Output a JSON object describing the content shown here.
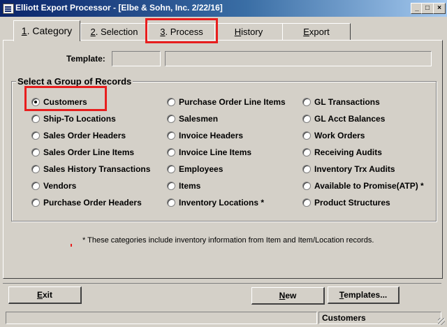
{
  "window": {
    "title": "Elliott Export Processor - [Elbe & Sohn, Inc. 2/22/16]",
    "minimize_glyph": "_",
    "maximize_glyph": "□",
    "close_glyph": "×"
  },
  "tabs": [
    {
      "key": "1",
      "label": ". Category",
      "active": true
    },
    {
      "key": "2",
      "label": ". Selection",
      "active": false
    },
    {
      "key": "3",
      "label": ". Process",
      "active": false
    },
    {
      "key": "H",
      "label": "istory",
      "active": false
    },
    {
      "key": "E",
      "label": "xport",
      "active": false
    }
  ],
  "template": {
    "label": "Template:",
    "code_value": "",
    "description_value": ""
  },
  "group": {
    "title": "Select a Group of Records",
    "selected": "Customers",
    "columns": [
      [
        "Customers",
        "Ship-To Locations",
        "Sales Order Headers",
        "Sales Order Line Items",
        "Sales History Transactions",
        "Vendors",
        "Purchase Order Headers"
      ],
      [
        "Purchase Order Line Items",
        "Salesmen",
        "Invoice Headers",
        "Invoice Line Items",
        "Employees",
        "Items",
        "Inventory Locations *"
      ],
      [
        "GL Transactions",
        "GL Acct Balances",
        "Work Orders",
        "Receiving Audits",
        "Inventory Trx Audits",
        "Available to Promise(ATP) *",
        "Product Structures"
      ]
    ]
  },
  "note": "* These categories include inventory information from Item and Item/Location records.",
  "buttons": {
    "exit_key": "E",
    "exit_rest": "xit",
    "new_key": "N",
    "new_rest": "ew",
    "templates_key": "T",
    "templates_rest": "emplates..."
  },
  "status": {
    "left": "",
    "right": "Customers"
  }
}
